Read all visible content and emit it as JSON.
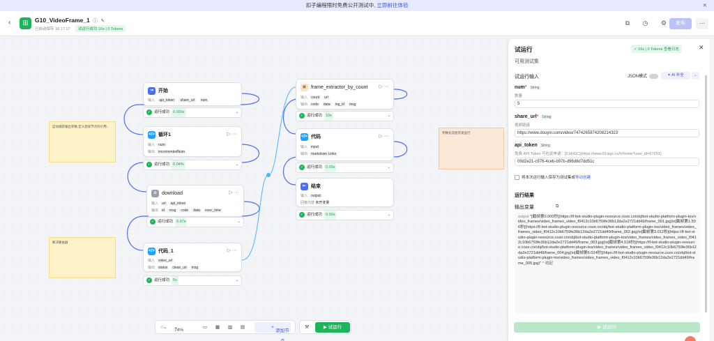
{
  "banner": {
    "text": "扣子编程限时免费公开测试中,",
    "link": "立即前往体验"
  },
  "header": {
    "app_title": "G10_VideoFrame_1",
    "autosave": "已自动保存 16:17:17",
    "run_badge": "试运行成功 16s | 0 Tokens",
    "publish_label": "发布"
  },
  "nodes": {
    "start": {
      "title": "开始",
      "inputs_label": "输入",
      "tags": [
        "api_token",
        "share_url",
        "num"
      ],
      "status": "运行成功",
      "time": "0.000s"
    },
    "loop1": {
      "title": "循环1",
      "in_label": "输入",
      "in_tag": "num",
      "out_label": "输出",
      "out_tag": "incrementedNum",
      "status": "运行成功",
      "time": "0.04%"
    },
    "download": {
      "title": "download",
      "in_label": "输入",
      "in_tags": [
        "url",
        "api_token"
      ],
      "out_label": "输出",
      "out_tags": [
        "id",
        "msg",
        "code",
        "data",
        "exec_time"
      ],
      "status": "运行成功",
      "time": "0.97s"
    },
    "code1": {
      "title": "代码_1",
      "in_label": "输入",
      "in_tag": "video_url",
      "out_label": "输出",
      "out_tags": [
        "status",
        "clean_url",
        "msg"
      ],
      "status": "运行成功",
      "time": "5s"
    },
    "frame": {
      "title": "frame_extractor_by_count",
      "in_label": "输入",
      "in_tags": [
        "count",
        "url"
      ],
      "out_label": "输出",
      "out_tags": [
        "code",
        "data",
        "log_id",
        "msg"
      ],
      "status": "运行成功",
      "time": "10s"
    },
    "code": {
      "title": "代码",
      "in_label": "输入",
      "in_tag": "input",
      "out_label": "输出",
      "out_tag": "markdown Links",
      "status": "运行成功",
      "time": "0.03s"
    },
    "end": {
      "title": "结束",
      "in_label": "输入",
      "in_tag": "output",
      "out_label": "回答内容",
      "out_value": "未开变量",
      "status": "运行成功",
      "time": "0.00s"
    }
  },
  "notes": {
    "note1": "自动捕获输出参数,定义后续节点的引用...",
    "note2": "解决路由器",
    "note3": "参数化流程开发运行"
  },
  "toolbar": {
    "zoom": "74%",
    "add_node": "添加节点",
    "run": "试运行"
  },
  "panel": {
    "title": "试运行",
    "badge": "16s | 0 Tokens 查看日志",
    "test_set": "可用测试集",
    "input_title": "试运行输入",
    "json_mode": "JSON模式",
    "ai_fill": "AI 补全",
    "fields": [
      {
        "name": "num",
        "required": "*",
        "type": "String",
        "desc": "数量",
        "value": "5"
      },
      {
        "name": "share_url",
        "required": "*",
        "type": "String",
        "desc": "视频链接",
        "value": "https://www.douyin.com/video/7474265874208214323"
      },
      {
        "name": "api_token",
        "required": "",
        "type": "String",
        "desc": "免费 API Token 可在此申请：[51AIGC](https://www.51aigc.cc/#/home?user_id=57201)",
        "value": "09d2e21-c976-4ceb-b97b-d96d8d7dd51c"
      }
    ],
    "save_checkbox": "将本次运行输入保存为测试集或",
    "save_link": "导动创建",
    "result_title": "运行结果",
    "output_title": "输出变量",
    "output_key": "output",
    "output_text": "\"[截帧第0.000秒](https://lf-bot-studio-plugin-resource.coze.cn/obj/bot-studio-platform-plugin-tos/video_frames/video_frames_video_f0412c10b6759fe36b12da2e2721dd49/frame_001.jpg)\\n[截帧第1.506秒](https://lf-bot-studio-plugin-resource.coze.cn/obj/bot-studio-platform-plugin-tos/video_frames/video_frames_video_f0412c10b6759fe36b12da2e2721dd49/frame_002.jpg)\\n[截帧第3.012秒](https://lf-bot-studio-plugin-resource.coze.cn/obj/bot-studio-platform-plugin-tos/video_frames/video_frames_video_f0412c10b6759fe36b12da2e2721dd49/frame_003.jpg)\\n[截帧第4.518秒](https://lf-bot-studio-plugin-resource.coze.cn/obj/bot-studio-platform-plugin-tos/video_frames/video_frames_video_f0412c10b6759fe36b12da2e2721dd49/frame_004.jpg)\\n[截帧第6.024秒](https://lf-bot-studio-plugin-resource.coze.cn/obj/bot-studio-platform-plugin-tos/video_frames/video_frames_video_f0412c10b6759fe36b12da2e2721dd49/frame_005.jpg)\"",
    "collapse": "^ 收起",
    "try_button": "试运行"
  },
  "colors": {
    "accent": "#1fb35b",
    "start_icon": "#4c6ef5",
    "code_icon": "#1fa2ff",
    "plugin_icon": "#9aa0ab",
    "end_icon": "#4c6ef5"
  }
}
